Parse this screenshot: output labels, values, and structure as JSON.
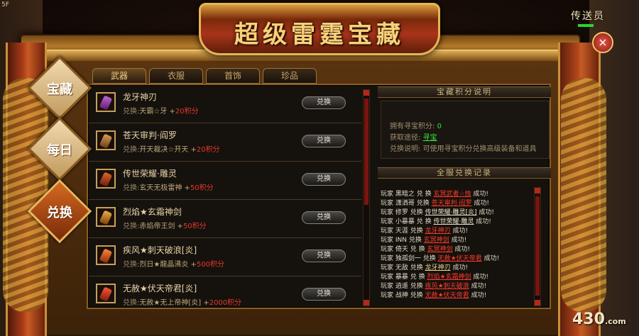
{
  "corner": "5F",
  "npc": {
    "name": "传送员"
  },
  "title": "超级雷霆宝藏",
  "close_icon": "×",
  "side_tabs": [
    {
      "label": "宝藏",
      "active": false
    },
    {
      "label": "每日",
      "active": false
    },
    {
      "label": "兑换",
      "active": true
    }
  ],
  "top_tabs": [
    {
      "label": "武器",
      "active": true
    },
    {
      "label": "衣服",
      "active": false
    },
    {
      "label": "首饰",
      "active": false
    },
    {
      "label": "珍品",
      "active": false
    }
  ],
  "items": [
    {
      "name": "龙牙神刃",
      "req_label": "兑换:",
      "req": "天霸☆牙 +",
      "points": "20积分",
      "button": "兑换"
    },
    {
      "name": "苍天审判·阎罗",
      "req_label": "兑换:",
      "req": "开天裁决☆开天 +",
      "points": "20积分",
      "button": "兑换"
    },
    {
      "name": "传世荣耀·雕灵",
      "req_label": "兑换:",
      "req": "玄天无极雷神 +",
      "points": "50积分",
      "button": "兑换"
    },
    {
      "name": "烈焰★玄霜神剑",
      "req_label": "兑换:",
      "req": "赤焰帝王剑 +",
      "points": "50积分",
      "button": "兑换"
    },
    {
      "name": "疾风★刺天破浪[炎]",
      "req_label": "兑换:",
      "req": "烈日★龍晶沸炎 +",
      "points": "500积分",
      "button": "兑换"
    },
    {
      "name": "无赦★伏天帝君[炎]",
      "req_label": "兑换:",
      "req": "无赦★无上帝神[炎] +",
      "points": "2000积分",
      "button": "兑换"
    }
  ],
  "info": {
    "header": "宝藏积分说明",
    "owned_label": "拥有寻宝积分:",
    "owned_value": "0",
    "source_label": "获取途径:",
    "source_value": "寻宝",
    "use_label": "兑换说明:",
    "use_value": "可使用寻宝积分兑换高级装备和道具"
  },
  "log": {
    "header": "全服兑换记录",
    "lines": [
      {
        "pre": "玩家 黑暗之 兑 换",
        "item": "玄冥武者☆烛",
        "post": "成功!"
      },
      {
        "pre": "玩家 潇洒哥 兑换",
        "item": "苍天审判·阎罗",
        "post": "成功!"
      },
      {
        "pre": "玩家 修罗 兑换",
        "item": "传世荣耀·雕灵[炎]",
        "post": "成功!"
      },
      {
        "pre": "玩家 小暴暴 兑 换",
        "item": "传世荣耀·雕灵",
        "post": "成功!"
      },
      {
        "pre": "玩家 天涯 兑换",
        "item": "龙牙神刃",
        "post": "成功!"
      },
      {
        "pre": "玩家 INN 兑换",
        "item": "玄冥神剑",
        "post": "成功!"
      },
      {
        "pre": "玩家 倚天 兑 换",
        "item": "玄冥神剑",
        "post": "成功!"
      },
      {
        "pre": "玩家 独孤剑一 兑换",
        "item": "无赦★伏天帝君",
        "post": "成功!"
      },
      {
        "pre": "玩家 无敌 兑换",
        "item": "龙牙神刃",
        "post": "成功!"
      },
      {
        "pre": "玩家 暴暴 兑 换",
        "item": "烈焰★玄霜神剑",
        "post": "成功!"
      },
      {
        "pre": "玩家 逍遥 兑换",
        "item": "疾风★刺天破浪",
        "post": "成功!"
      },
      {
        "pre": "玩家 战神 兑换",
        "item": "无赦★伏天帝君",
        "post": "成功!"
      }
    ]
  },
  "watermark": {
    "main": "430",
    "suffix": ".com"
  }
}
